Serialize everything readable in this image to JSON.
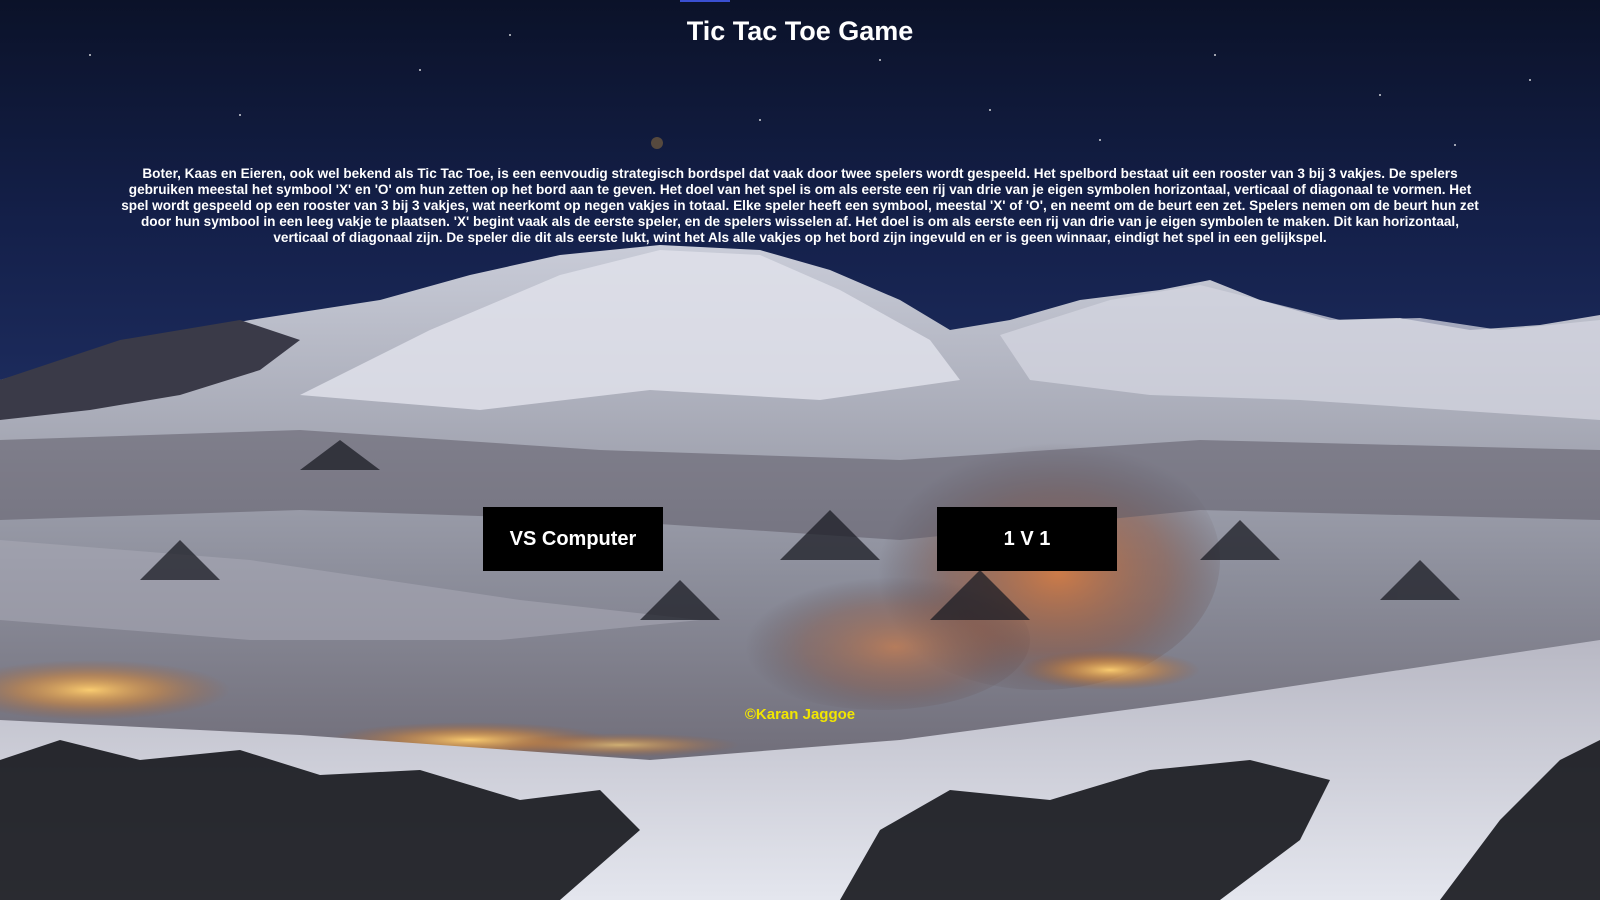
{
  "page": {
    "title": "Tic Tac Toe Game",
    "description": "Boter, Kaas en Eieren, ook wel bekend als Tic Tac Toe, is een eenvoudig strategisch bordspel dat vaak door twee spelers wordt gespeeld. Het spelbord bestaat uit een rooster van 3 bij 3 vakjes. De spelers gebruiken meestal het symbool 'X' en 'O' om hun zetten op het bord aan te geven. Het doel van het spel is om als eerste een rij van drie van je eigen symbolen horizontaal, verticaal of diagonaal te vormen. Het spel wordt gespeeld op een rooster van 3 bij 3 vakjes, wat neerkomt op negen vakjes in totaal. Elke speler heeft een symbool, meestal 'X' of 'O', en neemt om de beurt een zet. Spelers nemen om de beurt hun zet door hun symbool in een leeg vakje te plaatsen. 'X' begint vaak als de eerste speler, en de spelers wisselen af. Het doel is om als eerste een rij van drie van je eigen symbolen te maken. Dit kan horizontaal, verticaal of diagonaal zijn. De speler die dit als eerste lukt, wint het Als alle vakjes op het bord zijn ingevuld en er is geen winnaar, eindigt het spel in een gelijkspel.",
    "copyright": "©Karan Jaggoe"
  },
  "buttons": {
    "vs_computer": "VS Computer",
    "one_v_one": "1 V 1"
  },
  "colors": {
    "title": "#ffffff",
    "button_bg": "#000000",
    "button_text": "#ffffff",
    "copyright": "#f2e600",
    "sky": "#0d1530"
  }
}
